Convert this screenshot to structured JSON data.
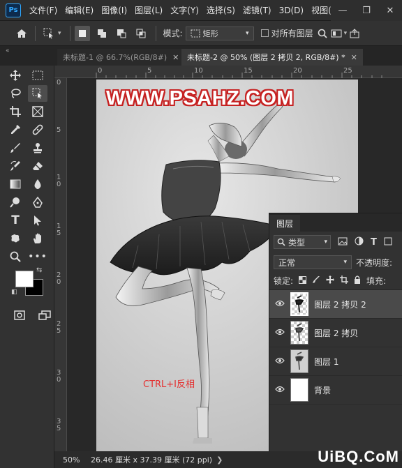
{
  "app": {
    "logo": "Ps"
  },
  "menu": [
    "文件(F)",
    "编辑(E)",
    "图像(I)",
    "图层(L)",
    "文字(Y)",
    "选择(S)",
    "滤镜(T)",
    "3D(D)",
    "视图(V"
  ],
  "window_controls": {
    "minimize": "—",
    "restore": "❐",
    "close": "✕"
  },
  "options": {
    "mode_label": "模式:",
    "mode_value": "矩形",
    "align_label": "对所有图层"
  },
  "tabs": [
    {
      "label": "未标题-1 @ 66.7%(RGB/8#)",
      "close": "✕"
    },
    {
      "label": "未标题-2 @ 50% (图层 2 拷贝 2, RGB/8#) *",
      "close": "✕"
    }
  ],
  "ruler": {
    "h": [
      "0",
      "5",
      "10",
      "15",
      "20",
      "25"
    ],
    "v": [
      "0",
      "5",
      "1\n0",
      "1\n5",
      "2\n0",
      "2\n5",
      "3\n0",
      "3\n5"
    ]
  },
  "watermark": "WWW.PSAHZ.COM",
  "annotation": "CTRL+I反相",
  "layers_panel": {
    "title": "图层",
    "filter_label": "类型",
    "blend_mode": "正常",
    "opacity_label": "不透明度:",
    "lock_label": "锁定:",
    "fill_label": "填充:",
    "layers": [
      {
        "name": "图层 2 拷贝 2",
        "selected": true
      },
      {
        "name": "图层 2 拷贝",
        "selected": false
      },
      {
        "name": "图层 1",
        "selected": false
      },
      {
        "name": "背景",
        "selected": false
      }
    ]
  },
  "status": {
    "zoom": "50%",
    "doc_info": "26.46 厘米 x 37.39 厘米 (72 ppi)",
    "arrow": "❯"
  },
  "site_watermark": "UiBQ.CoM",
  "colors": {
    "foreground": "#ffffff",
    "background": "#000000",
    "watermark_red": "#c62222",
    "annotation_red": "#e43030"
  }
}
